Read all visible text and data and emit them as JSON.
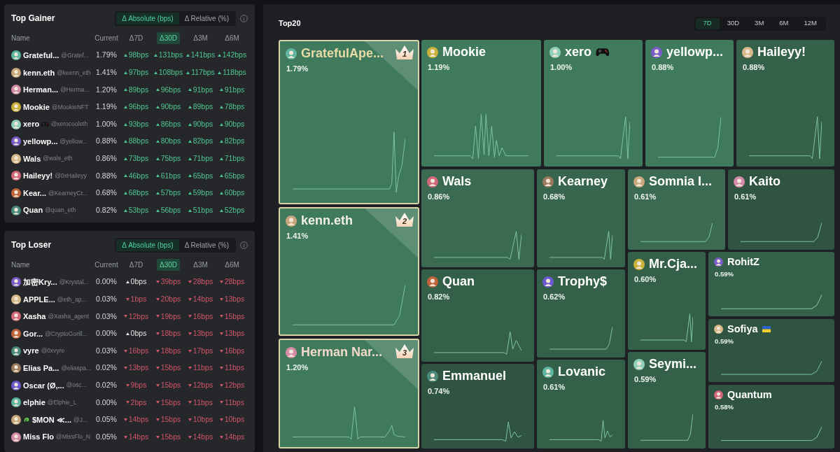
{
  "gainer": {
    "title": "Top Gainer",
    "modes": [
      {
        "label": "Δ Absolute (bps)",
        "selected": true
      },
      {
        "label": "Δ Relative (%)",
        "selected": false
      }
    ],
    "columns": [
      {
        "label": "Name",
        "selected": false
      },
      {
        "label": "Current",
        "selected": false
      },
      {
        "label": "Δ7D",
        "selected": false
      },
      {
        "label": "Δ30D",
        "selected": true
      },
      {
        "label": "Δ3M",
        "selected": false
      },
      {
        "label": "Δ6M",
        "selected": false
      }
    ],
    "rows": [
      {
        "user": {
          "kind": "plain",
          "name": "Grateful...",
          "handle": "@Gratef..."
        },
        "current": "1.79%",
        "d7": {
          "kind": "gain",
          "text": "98bps"
        },
        "d30": {
          "kind": "gain",
          "text": "131bps"
        },
        "d3m": {
          "kind": "gain",
          "text": "141bps"
        },
        "d6m": {
          "kind": "gain",
          "text": "142bps"
        }
      },
      {
        "user": {
          "kind": "plain",
          "name": "kenn.eth",
          "handle": "@keenn_eth"
        },
        "current": "1.41%",
        "d7": {
          "kind": "gain",
          "text": "97bps"
        },
        "d30": {
          "kind": "gain",
          "text": "108bps"
        },
        "d3m": {
          "kind": "gain",
          "text": "117bps"
        },
        "d6m": {
          "kind": "gain",
          "text": "118bps"
        }
      },
      {
        "user": {
          "kind": "plain",
          "name": "Herman...",
          "handle": "@Herma..."
        },
        "current": "1.20%",
        "d7": {
          "kind": "gain",
          "text": "89bps"
        },
        "d30": {
          "kind": "gain",
          "text": "96bps"
        },
        "d3m": {
          "kind": "gain",
          "text": "91bps"
        },
        "d6m": {
          "kind": "gain",
          "text": "91bps"
        }
      },
      {
        "user": {
          "kind": "plain",
          "name": "Mookie",
          "handle": "@MookieNFT"
        },
        "current": "1.19%",
        "d7": {
          "kind": "gain",
          "text": "96bps"
        },
        "d30": {
          "kind": "gain",
          "text": "90bps"
        },
        "d3m": {
          "kind": "gain",
          "text": "89bps"
        },
        "d6m": {
          "kind": "gain",
          "text": "78bps"
        }
      },
      {
        "user": {
          "kind": "gamepad",
          "name": "xero",
          "handle": "@xerocooleth"
        },
        "current": "1.00%",
        "d7": {
          "kind": "gain",
          "text": "93bps"
        },
        "d30": {
          "kind": "gain",
          "text": "86bps"
        },
        "d3m": {
          "kind": "gain",
          "text": "90bps"
        },
        "d6m": {
          "kind": "gain",
          "text": "90bps"
        }
      },
      {
        "user": {
          "kind": "plain",
          "name": "yellowp...",
          "handle": "@yellow..."
        },
        "current": "0.88%",
        "d7": {
          "kind": "gain",
          "text": "88bps"
        },
        "d30": {
          "kind": "gain",
          "text": "80bps"
        },
        "d3m": {
          "kind": "gain",
          "text": "82bps"
        },
        "d6m": {
          "kind": "gain",
          "text": "82bps"
        }
      },
      {
        "user": {
          "kind": "plain",
          "name": "Wals",
          "handle": "@wals_eth"
        },
        "current": "0.86%",
        "d7": {
          "kind": "gain",
          "text": "73bps"
        },
        "d30": {
          "kind": "gain",
          "text": "75bps"
        },
        "d3m": {
          "kind": "gain",
          "text": "71bps"
        },
        "d6m": {
          "kind": "gain",
          "text": "71bps"
        }
      },
      {
        "user": {
          "kind": "plain",
          "name": "Haileyy!",
          "handle": "@0xHaileyy"
        },
        "current": "0.88%",
        "d7": {
          "kind": "gain",
          "text": "46bps"
        },
        "d30": {
          "kind": "gain",
          "text": "61bps"
        },
        "d3m": {
          "kind": "gain",
          "text": "65bps"
        },
        "d6m": {
          "kind": "gain",
          "text": "65bps"
        }
      },
      {
        "user": {
          "kind": "plain",
          "name": "Kear...",
          "handle": "@KearneyCr..."
        },
        "current": "0.68%",
        "d7": {
          "kind": "gain",
          "text": "68bps"
        },
        "d30": {
          "kind": "gain",
          "text": "57bps"
        },
        "d3m": {
          "kind": "gain",
          "text": "59bps"
        },
        "d6m": {
          "kind": "gain",
          "text": "60bps"
        }
      },
      {
        "user": {
          "kind": "plain",
          "name": "Quan",
          "handle": "@quan_eth"
        },
        "current": "0.82%",
        "d7": {
          "kind": "gain",
          "text": "53bps"
        },
        "d30": {
          "kind": "gain",
          "text": "56bps"
        },
        "d3m": {
          "kind": "gain",
          "text": "51bps"
        },
        "d6m": {
          "kind": "gain",
          "text": "52bps"
        }
      }
    ]
  },
  "loser": {
    "title": "Top Loser",
    "modes": [
      {
        "label": "Δ Absolute (bps)",
        "selected": true
      },
      {
        "label": "Δ Relative (%)",
        "selected": false
      }
    ],
    "columns": [
      {
        "label": "Name",
        "selected": false
      },
      {
        "label": "Current",
        "selected": false
      },
      {
        "label": "Δ7D",
        "selected": false
      },
      {
        "label": "Δ30D",
        "selected": true
      },
      {
        "label": "Δ3M",
        "selected": false
      },
      {
        "label": "Δ6M",
        "selected": false
      }
    ],
    "rows": [
      {
        "user": {
          "kind": "plain",
          "name": "加密Kry...",
          "handle": "@Krystal..."
        },
        "current": "0.00%",
        "d7": {
          "kind": "flat",
          "text": "0bps"
        },
        "d30": {
          "kind": "loss",
          "text": "39bps"
        },
        "d3m": {
          "kind": "loss",
          "text": "28bps"
        },
        "d6m": {
          "kind": "loss",
          "text": "28bps"
        }
      },
      {
        "user": {
          "kind": "plain",
          "name": "APPLE...",
          "handle": "@eth_ap..."
        },
        "current": "0.03%",
        "d7": {
          "kind": "loss",
          "text": "1bps"
        },
        "d30": {
          "kind": "loss",
          "text": "20bps"
        },
        "d3m": {
          "kind": "loss",
          "text": "14bps"
        },
        "d6m": {
          "kind": "loss",
          "text": "13bps"
        }
      },
      {
        "user": {
          "kind": "plain",
          "name": "Xasha",
          "handle": "@Xasha_agent"
        },
        "current": "0.03%",
        "d7": {
          "kind": "loss",
          "text": "12bps"
        },
        "d30": {
          "kind": "loss",
          "text": "19bps"
        },
        "d3m": {
          "kind": "loss",
          "text": "16bps"
        },
        "d6m": {
          "kind": "loss",
          "text": "15bps"
        }
      },
      {
        "user": {
          "kind": "plain",
          "name": "Gor...",
          "handle": "@CryptoGorill..."
        },
        "current": "0.00%",
        "d7": {
          "kind": "flat",
          "text": "0bps"
        },
        "d30": {
          "kind": "loss",
          "text": "18bps"
        },
        "d3m": {
          "kind": "loss",
          "text": "13bps"
        },
        "d6m": {
          "kind": "loss",
          "text": "13bps"
        }
      },
      {
        "user": {
          "kind": "plain",
          "name": "vyre",
          "handle": "@0xvyre"
        },
        "current": "0.03%",
        "d7": {
          "kind": "loss",
          "text": "16bps"
        },
        "d30": {
          "kind": "loss",
          "text": "18bps"
        },
        "d3m": {
          "kind": "loss",
          "text": "17bps"
        },
        "d6m": {
          "kind": "loss",
          "text": "16bps"
        }
      },
      {
        "user": {
          "kind": "plain",
          "name": "Elias Pa...",
          "handle": "@eliaspa..."
        },
        "current": "0.02%",
        "d7": {
          "kind": "loss",
          "text": "13bps"
        },
        "d30": {
          "kind": "loss",
          "text": "15bps"
        },
        "d3m": {
          "kind": "loss",
          "text": "11bps"
        },
        "d6m": {
          "kind": "loss",
          "text": "11bps"
        }
      },
      {
        "user": {
          "kind": "plain",
          "name": "Oscar (Ø,...",
          "handle": "@osc..."
        },
        "current": "0.02%",
        "d7": {
          "kind": "loss",
          "text": "9bps"
        },
        "d30": {
          "kind": "loss",
          "text": "15bps"
        },
        "d3m": {
          "kind": "loss",
          "text": "12bps"
        },
        "d6m": {
          "kind": "loss",
          "text": "12bps"
        }
      },
      {
        "user": {
          "kind": "plain",
          "name": "elphie",
          "handle": "@Elphie_L"
        },
        "current": "0.00%",
        "d7": {
          "kind": "loss",
          "text": "2bps"
        },
        "d30": {
          "kind": "loss",
          "text": "15bps"
        },
        "d3m": {
          "kind": "loss",
          "text": "11bps"
        },
        "d6m": {
          "kind": "loss",
          "text": "11bps"
        }
      },
      {
        "user": {
          "kind": "dragon",
          "name": "$MON ≪...",
          "handle": "@J..."
        },
        "current": "0.05%",
        "d7": {
          "kind": "loss",
          "text": "14bps"
        },
        "d30": {
          "kind": "loss",
          "text": "15bps"
        },
        "d3m": {
          "kind": "loss",
          "text": "10bps"
        },
        "d6m": {
          "kind": "loss",
          "text": "10bps"
        }
      },
      {
        "user": {
          "kind": "plain",
          "name": "Miss Flo",
          "handle": "@MissFlo_N"
        },
        "current": "0.05%",
        "d7": {
          "kind": "loss",
          "text": "14bps"
        },
        "d30": {
          "kind": "loss",
          "text": "15bps"
        },
        "d3m": {
          "kind": "loss",
          "text": "14bps"
        },
        "d6m": {
          "kind": "loss",
          "text": "14bps"
        }
      }
    ]
  },
  "top20": {
    "title": "Top20",
    "periods": [
      {
        "label": "7D",
        "selected": true
      },
      {
        "label": "30D",
        "selected": false
      },
      {
        "label": "3M",
        "selected": false
      },
      {
        "label": "6M",
        "selected": false
      },
      {
        "label": "12M",
        "selected": false
      }
    ],
    "tiles": [
      {
        "kind": "plain",
        "name": "GratefulApe...",
        "share": "1.79%",
        "rank": "1",
        "color": "#3f7a5c"
      },
      {
        "kind": "plain",
        "name": "kenn.eth",
        "share": "1.41%",
        "rank": "2",
        "color": "#3f7a5c"
      },
      {
        "kind": "plain",
        "name": "Herman Nar...",
        "share": "1.20%",
        "rank": "3",
        "color": "#3f7a5c"
      },
      {
        "kind": "plain",
        "name": "Mookie",
        "share": "1.19%",
        "color": "#3f7a5c"
      },
      {
        "kind": "gamepad",
        "name": "xero",
        "share": "1.00%",
        "color": "#3f7a5c"
      },
      {
        "kind": "plain",
        "name": "yellowp...",
        "share": "0.88%",
        "color": "#3f7a5c"
      },
      {
        "kind": "plain",
        "name": "Haileyy!",
        "share": "0.88%",
        "color": "#35604a"
      },
      {
        "kind": "plain",
        "name": "Wals",
        "share": "0.86%",
        "color": "#3a6a51"
      },
      {
        "kind": "plain",
        "name": "Quan",
        "share": "0.82%",
        "color": "#34604a"
      },
      {
        "kind": "plain",
        "name": "Emmanuel",
        "share": "0.74%",
        "color": "#2f5442"
      },
      {
        "kind": "plain",
        "name": "Kearney",
        "share": "0.68%",
        "color": "#37654e"
      },
      {
        "kind": "plain",
        "name": "Trophy$",
        "share": "0.62%",
        "color": "#34604a"
      },
      {
        "kind": "plain",
        "name": "Lovanic",
        "share": "0.61%",
        "color": "#34604a"
      },
      {
        "kind": "plain",
        "name": "Somnia I...",
        "share": "0.61%",
        "color": "#3a6a51"
      },
      {
        "kind": "plain",
        "name": "Kaito",
        "share": "0.61%",
        "color": "#2f5442"
      },
      {
        "kind": "plain",
        "name": "Mr.Cja...",
        "share": "0.60%",
        "color": "#34604a"
      },
      {
        "kind": "plain",
        "name": "Seymi...",
        "share": "0.59%",
        "color": "#34604a"
      },
      {
        "kind": "plain",
        "name": "RohitZ",
        "share": "0.59%",
        "color": "#34604a"
      },
      {
        "kind": "flag",
        "name": "Sofiya",
        "share": "0.59%",
        "color": "#2f5442"
      },
      {
        "kind": "plain",
        "name": "Quantum",
        "share": "0.58%",
        "color": "#2f5442"
      }
    ]
  }
}
